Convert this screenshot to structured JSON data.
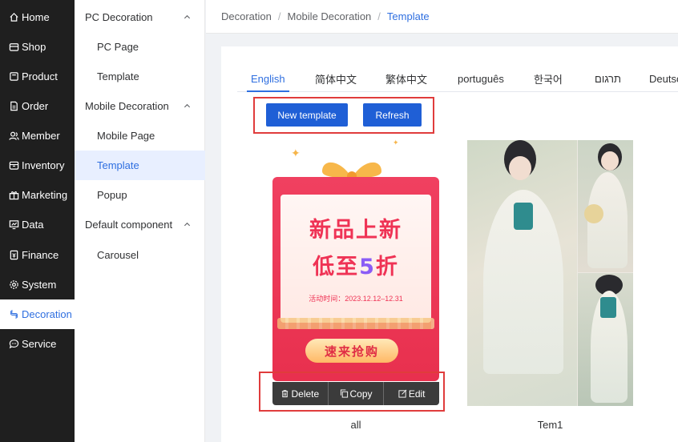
{
  "nav": {
    "items": [
      {
        "label": "Home",
        "icon": "home-icon"
      },
      {
        "label": "Shop",
        "icon": "shop-icon"
      },
      {
        "label": "Product",
        "icon": "product-icon"
      },
      {
        "label": "Order",
        "icon": "order-icon"
      },
      {
        "label": "Member",
        "icon": "member-icon"
      },
      {
        "label": "Inventory",
        "icon": "inventory-icon"
      },
      {
        "label": "Marketing",
        "icon": "gift-icon"
      },
      {
        "label": "Data",
        "icon": "data-icon"
      },
      {
        "label": "Finance",
        "icon": "finance-icon"
      },
      {
        "label": "System",
        "icon": "gear-icon"
      },
      {
        "label": "Decoration",
        "icon": "decoration-icon",
        "active": true
      },
      {
        "label": "Service",
        "icon": "chat-icon"
      }
    ]
  },
  "submenu": {
    "pc_group": "PC Decoration",
    "pc_page": "PC Page",
    "pc_template": "Template",
    "mobile_group": "Mobile Decoration",
    "mobile_page": "Mobile Page",
    "mobile_template": "Template",
    "popup": "Popup",
    "default_group": "Default component",
    "carousel": "Carousel"
  },
  "breadcrumb": {
    "items": [
      "Decoration",
      "Mobile Decoration",
      "Template"
    ],
    "separator": "/"
  },
  "tabs": [
    "English",
    "简体中文",
    "繁体中文",
    "português",
    "한국어",
    "תרגום",
    "Deutsch"
  ],
  "toolbar": {
    "new_template": "New template",
    "refresh": "Refresh"
  },
  "templates": [
    {
      "name": "all",
      "poster": {
        "line1": "新品上新",
        "line2_prefix": "低至",
        "line2_number": "5",
        "line2_suffix": "折",
        "date": "活动时间：2023.12.12–12.31",
        "cta": "速来抢购"
      },
      "actions": {
        "delete": "Delete",
        "copy": "Copy",
        "edit": "Edit"
      }
    },
    {
      "name": "Tem1"
    }
  ],
  "colors": {
    "accent": "#2f6fe0",
    "primary_button": "#1f5fd6",
    "nav_bg": "#1f1f1f",
    "highlight_border": "#e03c3c"
  }
}
